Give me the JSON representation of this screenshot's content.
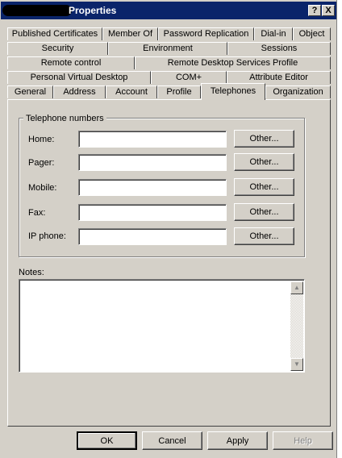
{
  "window": {
    "title": "Properties",
    "help_button": "?",
    "close_button": "X"
  },
  "tabs": {
    "row1": [
      {
        "label": "Published Certificates"
      },
      {
        "label": "Member Of"
      },
      {
        "label": "Password Replication"
      },
      {
        "label": "Dial-in"
      },
      {
        "label": "Object"
      }
    ],
    "row2": [
      {
        "label": "Security"
      },
      {
        "label": "Environment"
      },
      {
        "label": "Sessions"
      }
    ],
    "row3": [
      {
        "label": "Remote control"
      },
      {
        "label": "Remote Desktop Services Profile"
      }
    ],
    "row4": [
      {
        "label": "Personal Virtual Desktop"
      },
      {
        "label": "COM+"
      },
      {
        "label": "Attribute Editor"
      }
    ],
    "row5": [
      {
        "label": "General"
      },
      {
        "label": "Address"
      },
      {
        "label": "Account"
      },
      {
        "label": "Profile"
      },
      {
        "label": "Telephones"
      },
      {
        "label": "Organization"
      }
    ],
    "active": "Telephones"
  },
  "telephones": {
    "group_label": "Telephone numbers",
    "rows": [
      {
        "label": "Home:",
        "value": "",
        "button": "Other..."
      },
      {
        "label": "Pager:",
        "value": "",
        "button": "Other..."
      },
      {
        "label": "Mobile:",
        "value": "",
        "button": "Other..."
      },
      {
        "label": "Fax:",
        "value": "",
        "button": "Other..."
      },
      {
        "label": "IP phone:",
        "value": "",
        "button": "Other..."
      }
    ],
    "notes_label": "Notes:",
    "notes_value": ""
  },
  "footer": {
    "ok": "OK",
    "cancel": "Cancel",
    "apply": "Apply",
    "help": "Help"
  },
  "icons": {
    "scroll_up": "up-arrow-icon",
    "scroll_down": "down-arrow-icon"
  }
}
